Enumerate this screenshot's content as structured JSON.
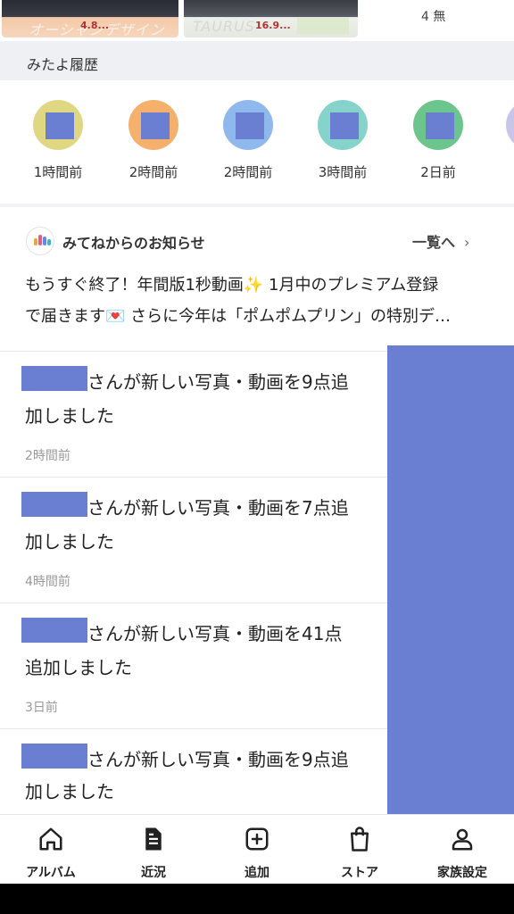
{
  "top_strip": {
    "thumb1_text": "オーシャンデザイン",
    "thumb1_badge": "4.8...",
    "thumb2_text": "TAURUS",
    "thumb2_badge": "16.9...",
    "right_text": "4 無"
  },
  "history": {
    "title": "みたよ履歴",
    "avatars": [
      {
        "label": "1時間前",
        "ring": "#dfd782"
      },
      {
        "label": "2時間前",
        "ring": "#f5b06c"
      },
      {
        "label": "2時間前",
        "ring": "#8fb8ec"
      },
      {
        "label": "3時間前",
        "ring": "#86d3cc"
      },
      {
        "label": "2日前",
        "ring": "#6bc58d"
      }
    ]
  },
  "news": {
    "title": "みてねからのお知らせ",
    "more_label": "一覧へ",
    "line1": "もうすぐ終了！年間版1秒動画✨ 1月中のプレミアム登録",
    "line2": "で届きます💌 さらに今年は「ポムポムプリン」の特別デ…"
  },
  "feed": [
    {
      "line1": "さんが新しい写真・動画を9点追",
      "line2": "加しました",
      "time": "2時間前"
    },
    {
      "line1": "さんが新しい写真・動画を7点追",
      "line2": "加しました",
      "time": "4時間前"
    },
    {
      "line1": "さんが新しい写真・動画を41点",
      "line2": "追加しました",
      "time": "3日前"
    },
    {
      "line1": "さんが新しい写真・動画を9点追",
      "line2": "加しました",
      "time": ""
    }
  ],
  "bottom_nav": [
    {
      "label": "アルバム",
      "icon": "home-icon"
    },
    {
      "label": "近況",
      "icon": "document-icon"
    },
    {
      "label": "追加",
      "icon": "add-square-icon"
    },
    {
      "label": "ストア",
      "icon": "shopping-bag-icon"
    },
    {
      "label": "家族設定",
      "icon": "person-icon"
    }
  ],
  "colors": {
    "redaction": "#6a7fd2",
    "history_bg": "#eef0f4"
  }
}
